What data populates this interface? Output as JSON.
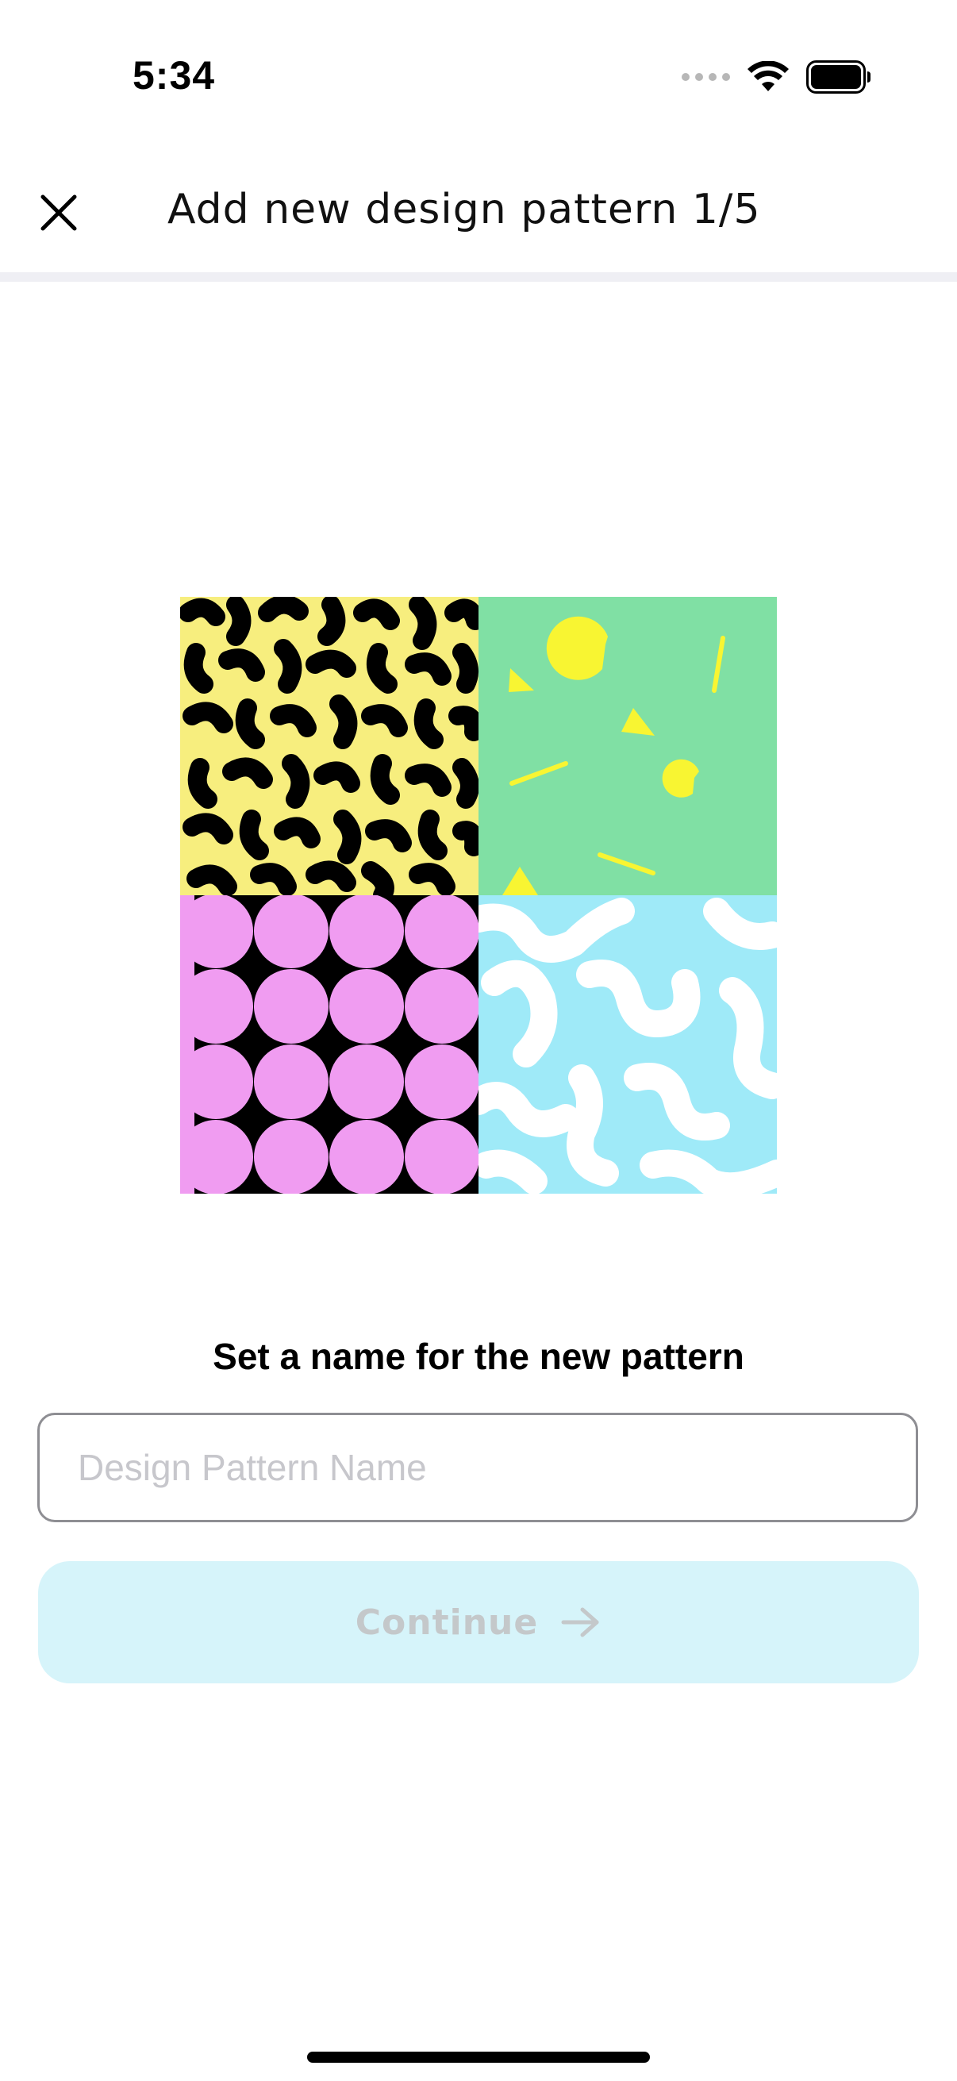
{
  "status_bar": {
    "time": "5:34",
    "icons": [
      "signal-dots-icon",
      "wifi-icon",
      "battery-icon"
    ]
  },
  "header": {
    "close_icon": "close-icon",
    "title": "Add new design pattern 1/5"
  },
  "illustration": {
    "tiles": [
      {
        "name": "yellow-black-blob-pattern",
        "background": "#f7ee7e",
        "accent": "#000000"
      },
      {
        "name": "green-confetti-pattern",
        "background": "#80e0a4",
        "accent": "#f8f532"
      },
      {
        "name": "pink-star-pattern",
        "background": "#f09cf1",
        "accent": "#000000"
      },
      {
        "name": "blue-wave-pattern",
        "background": "#9feaf8",
        "accent": "#ffffff"
      }
    ]
  },
  "form": {
    "prompt": "Set a name for the new pattern",
    "name_placeholder": "Design Pattern Name",
    "name_value": ""
  },
  "actions": {
    "continue_label": "Continue",
    "continue_icon": "arrow-right-icon"
  },
  "colors": {
    "continue_bg": "#d6f4fa",
    "continue_text": "#c4c8ca",
    "divider": "#efeff4"
  }
}
